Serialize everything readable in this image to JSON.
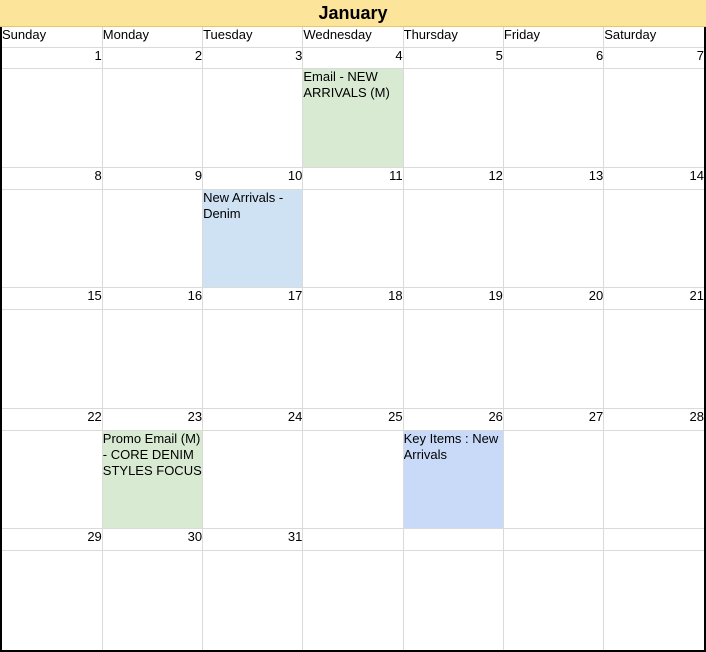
{
  "calendar": {
    "month": "January",
    "weekdays": [
      "Sunday",
      "Monday",
      "Tuesday",
      "Wednesday",
      "Thursday",
      "Friday",
      "Saturday"
    ],
    "weeks": [
      {
        "days": [
          "1",
          "2",
          "3",
          "4",
          "5",
          "6",
          "7"
        ],
        "events": [
          "",
          "",
          "",
          "Email -  NEW ARRIVALS (M)",
          "",
          "",
          ""
        ]
      },
      {
        "days": [
          "8",
          "9",
          "10",
          "11",
          "12",
          "13",
          "14"
        ],
        "events": [
          "",
          "",
          "New Arrivals - Denim",
          "",
          "",
          "",
          ""
        ]
      },
      {
        "days": [
          "15",
          "16",
          "17",
          "18",
          "19",
          "20",
          "21"
        ],
        "events": [
          "",
          "",
          "",
          "",
          "",
          "",
          ""
        ]
      },
      {
        "days": [
          "22",
          "23",
          "24",
          "25",
          "26",
          "27",
          "28"
        ],
        "events": [
          "",
          "Promo Email (M) - CORE DENIM STYLES FOCUS",
          "",
          "",
          "Key Items : New Arrivals",
          "",
          ""
        ]
      },
      {
        "days": [
          "29",
          "30",
          "31",
          "",
          "",
          "",
          ""
        ],
        "events": [
          "",
          "",
          "",
          "",
          "",
          "",
          ""
        ]
      }
    ]
  },
  "colors": {
    "title_bg": "#fde49b",
    "event_green": "#d9ead3",
    "event_light_blue": "#cfe2f3",
    "event_blue": "#c9daf8",
    "grid_line": "#dadada"
  }
}
